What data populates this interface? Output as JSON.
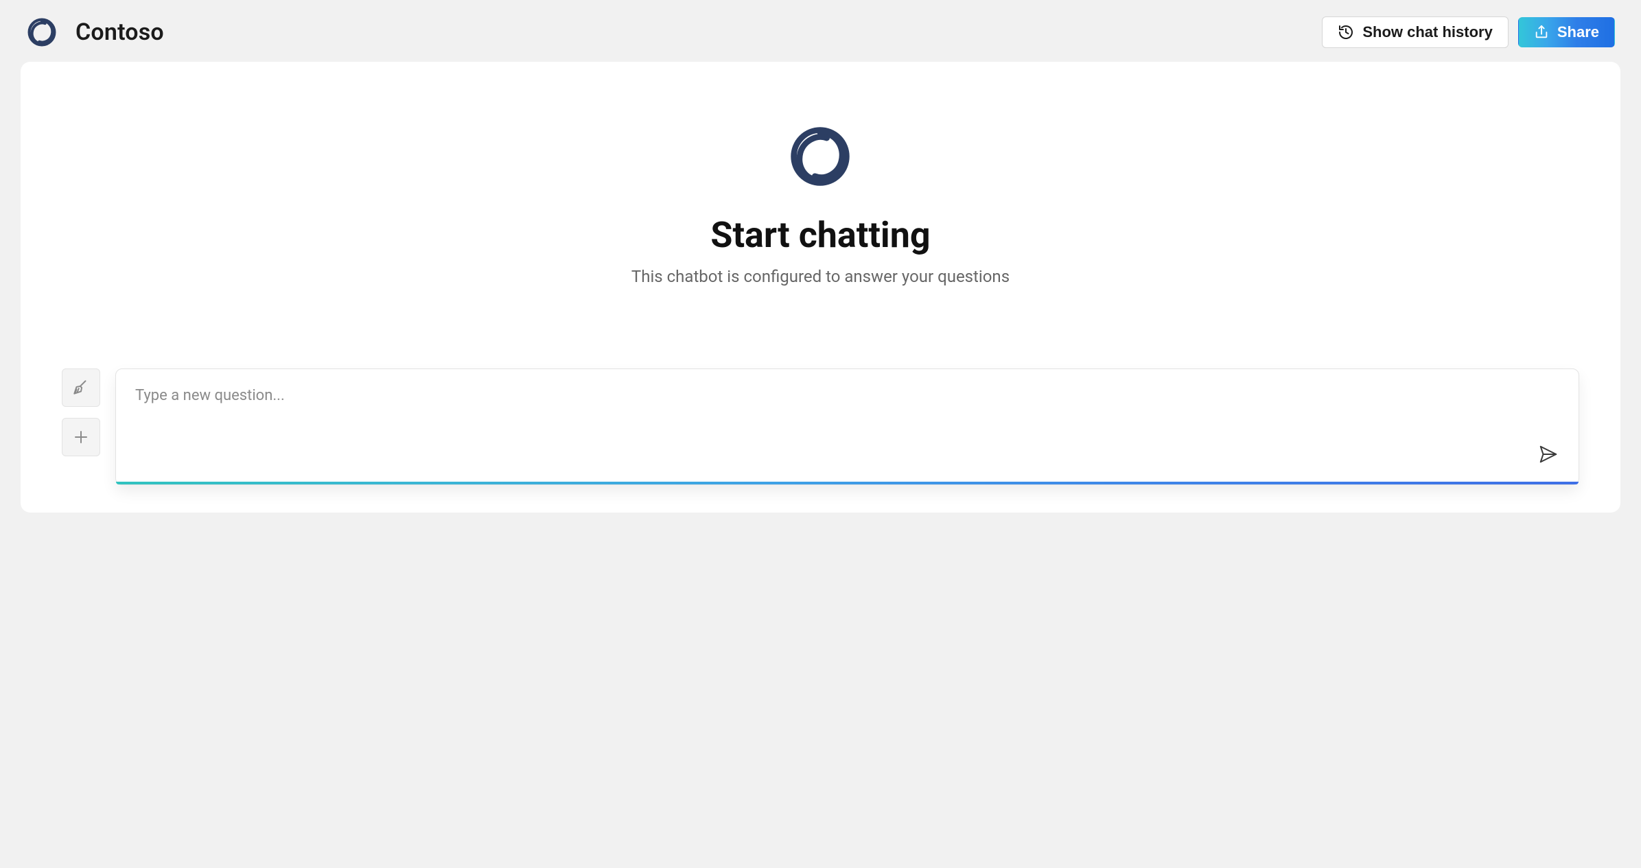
{
  "header": {
    "brand_title": "Contoso",
    "show_history_label": "Show chat history",
    "share_label": "Share"
  },
  "hero": {
    "title": "Start chatting",
    "subtitle": "This chatbot is configured to answer your questions"
  },
  "composer": {
    "placeholder": "Type a new question...",
    "value": ""
  },
  "colors": {
    "brand": "#2c3e63",
    "gradient_start": "#31c3bf",
    "gradient_end": "#3e6fe6"
  }
}
